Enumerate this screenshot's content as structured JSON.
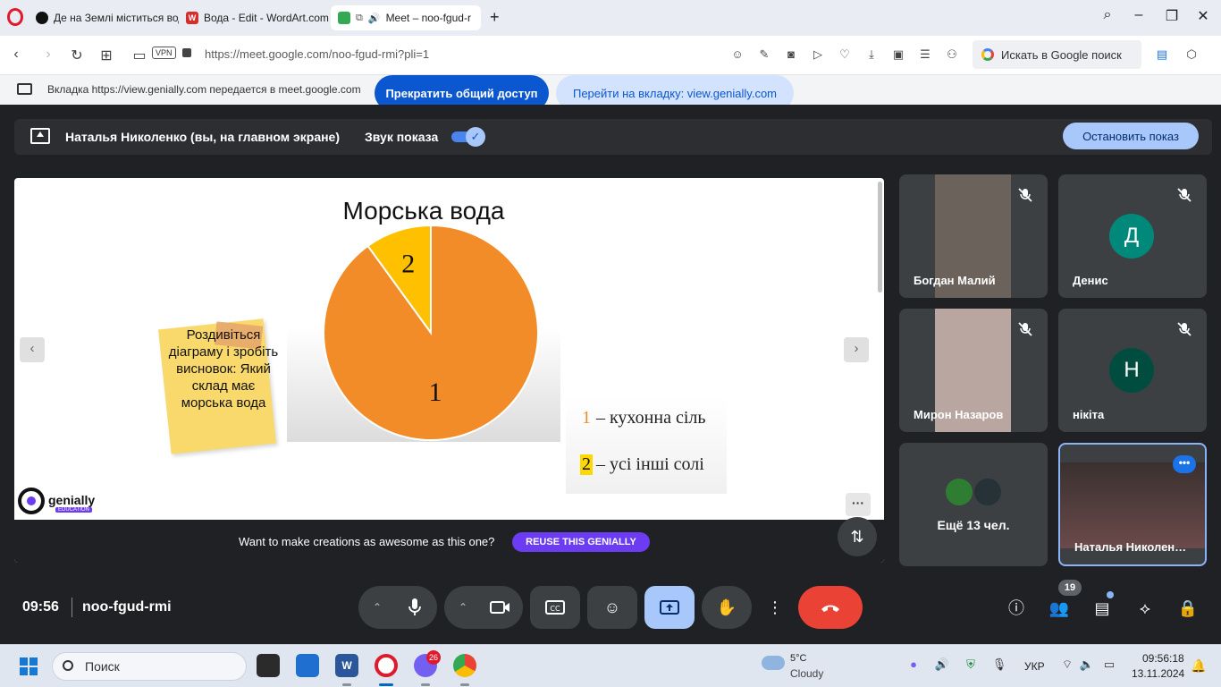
{
  "browser": {
    "tabs": [
      {
        "title": "Де на Землі міститься вод",
        "favicon": "genially"
      },
      {
        "title": "Вода - Edit - WordArt.com",
        "favicon": "wordart"
      },
      {
        "title": "Meet – noo-fgud-r",
        "favicon": "meet"
      }
    ],
    "new_tab": "+",
    "url": "https://meet.google.com/noo-fgud-rmi?pli=1",
    "vpn_label": "VPN",
    "search_placeholder": "Искать в Google поиск"
  },
  "share_notice": {
    "message": "Вкладка https://view.genially.com передается в meet.google.com",
    "stop_label": "Прекратить общий доступ",
    "goto_label": "Перейти на вкладку: view.genially.com"
  },
  "presenter_bar": {
    "presenter_name": "Наталья Николенко (вы, на главном экране)",
    "sound_label": "Звук показа",
    "sound_on": true,
    "stop_label": "Остановить показ"
  },
  "slide": {
    "sticky_note": "Роздивіться діаграму і зробіть висновок: Який склад має морська вода",
    "legend": [
      {
        "num": "1",
        "text": "– кухонна сіль",
        "num_color": "#f28c28",
        "highlight": "transparent"
      },
      {
        "num": "2",
        "text": "– усі інші солі",
        "num_color": "#111111",
        "highlight": "#ffd800"
      }
    ],
    "prev": "‹",
    "next": "›",
    "genially_name": "genially",
    "genially_edu": "EDUCATION",
    "more": "···",
    "reuse_text": "Want to make creations as awesome as this one?",
    "reuse_button": "REUSE THIS GENIALLY"
  },
  "chart_data": {
    "type": "pie",
    "title": "Морська вода",
    "categories": [
      "1",
      "2"
    ],
    "values": [
      90,
      10
    ],
    "colors": [
      "#f28c28",
      "#ffc000"
    ],
    "legend": "bottom-right"
  },
  "participants": [
    {
      "name": "Богдан Малий",
      "muted": true,
      "type": "video",
      "bg": "#6b625c"
    },
    {
      "name": "Денис",
      "muted": true,
      "type": "avatar",
      "initial": "Д",
      "color": "#00897b"
    },
    {
      "name": "Мирон Назаров",
      "muted": true,
      "type": "video",
      "bg": "#b9a6a0"
    },
    {
      "name": "нікіта",
      "muted": true,
      "type": "avatar",
      "initial": "Н",
      "color": "#004d40"
    },
    {
      "name": "Ещё 13 чел.",
      "type": "more"
    },
    {
      "name": "Наталья Николен…",
      "type": "self"
    }
  ],
  "controls": {
    "time": "09:56",
    "meeting_code": "noo-fgud-rmi",
    "people_count": "19"
  },
  "taskbar": {
    "search": "Поиск",
    "viber_badge": "26",
    "weather_temp": "5°C",
    "weather_desc": "Cloudy",
    "lang": "УКР",
    "time": "09:56:18",
    "date": "13.11.2024"
  }
}
